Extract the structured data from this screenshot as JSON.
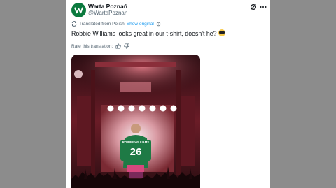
{
  "post": {
    "author_name": "Warta Poznań",
    "author_handle": "@WartaPoznan",
    "translation_note": "Translated from Polish",
    "show_original_label": "Show original",
    "text": "Robbie Williams looks great in our t-shirt, doesn't he?",
    "emoji": "sunglasses-emoji",
    "rate_label": "Rate this translation:"
  },
  "photo": {
    "shirt_name": "ROBBIE WILLIAMS",
    "shirt_number": "26"
  },
  "colors": {
    "accent": "#1d9bf0",
    "club_green": "#0b7a3e",
    "text_primary": "#0f1419",
    "text_secondary": "#536471"
  }
}
